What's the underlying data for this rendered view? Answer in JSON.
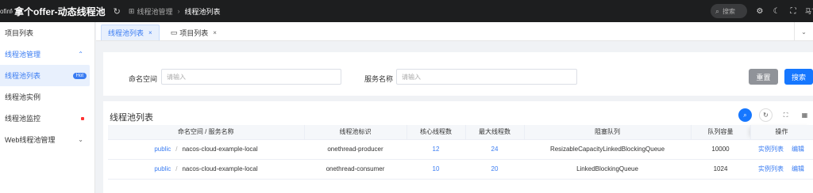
{
  "header": {
    "logo_text": "ofinfo",
    "app_title": "拿个offer-动态线程池",
    "refresh_icon": "refresh-icon",
    "breadcrumb": {
      "parent": "线程池管理",
      "current": "线程池列表"
    },
    "search_label": "搜索",
    "icons": [
      "settings-icon",
      "moon-icon",
      "fullscreen-icon"
    ],
    "user_text": "马丁"
  },
  "sidebar": {
    "items": [
      {
        "label": "项目列表"
      },
      {
        "label": "线程池管理"
      },
      {
        "label": "线程池列表",
        "badge": "Hot"
      },
      {
        "label": "线程池实例"
      },
      {
        "label": "线程池监控"
      },
      {
        "label": "Web线程池管理"
      }
    ]
  },
  "tabs": [
    {
      "label": "线程池列表",
      "close": "×"
    },
    {
      "label": "项目列表",
      "close": "×"
    }
  ],
  "filter": {
    "namespace_label": "命名空间",
    "namespace_placeholder": "请输入",
    "service_label": "服务名称",
    "service_placeholder": "请输入",
    "reset_label": "重置",
    "search_label": "搜索"
  },
  "table": {
    "title": "线程池列表",
    "columns": [
      "命名空间 / 服务名称",
      "线程池标识",
      "核心线程数",
      "最大线程数",
      "阻塞队列",
      "队列容量",
      "操作"
    ],
    "rows": [
      {
        "namespace": "public",
        "service": "nacos-cloud-example-local",
        "thread_pool_id": "onethread-producer",
        "core": "12",
        "max": "24",
        "queue": "ResizableCapacityLinkedBlockingQueue",
        "capacity": "10000",
        "op1": "实例列表",
        "op2": "编辑"
      },
      {
        "namespace": "public",
        "service": "nacos-cloud-example-local",
        "thread_pool_id": "onethread-consumer",
        "core": "10",
        "max": "20",
        "queue": "LinkedBlockingQueue",
        "capacity": "1024",
        "op1": "实例列表",
        "op2": "编辑"
      }
    ]
  },
  "colors": {
    "accent": "#1677ff",
    "link": "#3a7cf2",
    "header_bg": "#1d1e1f",
    "reset_bg": "#909399"
  }
}
